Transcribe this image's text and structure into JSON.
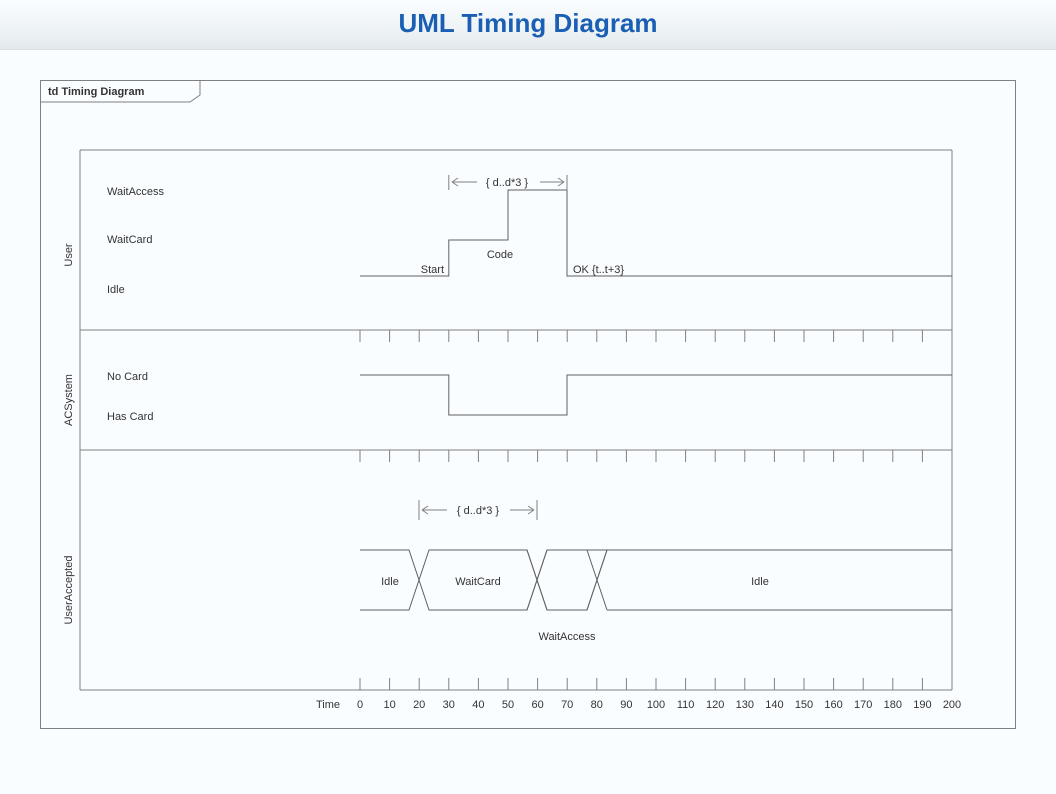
{
  "title": "UML Timing Diagram",
  "frame_label": "td Timing Diagram",
  "time_label": "Time",
  "time_axis": {
    "start": 0,
    "end": 200,
    "step": 10
  },
  "lifelines": {
    "user": {
      "name": "User",
      "states": [
        "WaitAccess",
        "WaitCard",
        "Idle"
      ],
      "constraint": "{ d..d*3 }",
      "events": {
        "start": "Start",
        "code": "Code",
        "ok": "OK {t..t+3}"
      },
      "waveform": [
        {
          "t": 0,
          "state": "Idle"
        },
        {
          "t": 30,
          "state": "WaitCard"
        },
        {
          "t": 70,
          "state": "WaitAccess"
        },
        {
          "t": 70,
          "state": "Idle"
        }
      ]
    },
    "acsystem": {
      "name": "ACSystem",
      "states": [
        "No Card",
        "Has Card"
      ],
      "waveform": [
        {
          "t": 0,
          "state": "No Card"
        },
        {
          "t": 30,
          "state": "Has Card"
        },
        {
          "t": 70,
          "state": "No Card"
        }
      ]
    },
    "useraccepted": {
      "name": "UserAccepted",
      "constraint": "{ d..d*3 }",
      "value_timeline": [
        {
          "from": 0,
          "to": 20,
          "value": "Idle"
        },
        {
          "from": 20,
          "to": 60,
          "value": "WaitCard"
        },
        {
          "from": 60,
          "to": 80,
          "value": "WaitAccess"
        },
        {
          "from": 80,
          "to": 200,
          "value": "Idle"
        }
      ]
    }
  }
}
